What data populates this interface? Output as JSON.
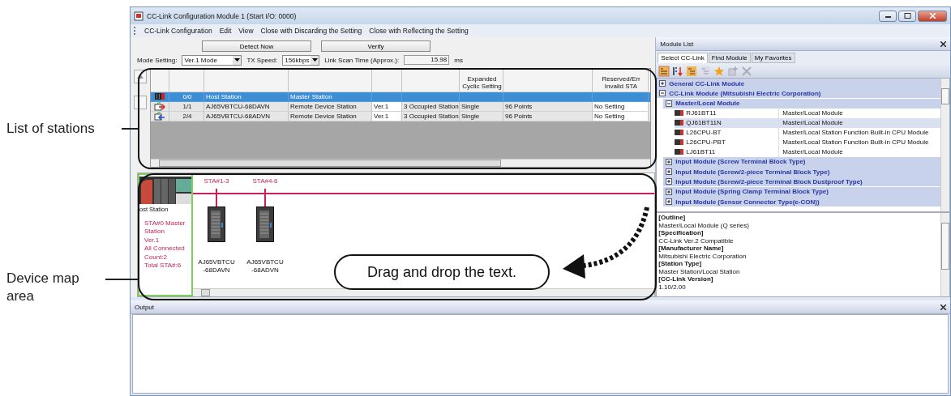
{
  "annotations": [
    {
      "text": "List of stations"
    },
    {
      "text": "Device map area"
    }
  ],
  "callout": {
    "text": "Drag and drop the text."
  },
  "window": {
    "title": "CC-Link Configuration Module 1 (Start I/O: 0000)"
  },
  "menu": [
    "CC-Link Configuration",
    "Edit",
    "View",
    "Close with Discarding the Setting",
    "Close with Reflecting the Setting"
  ],
  "toolbar": {
    "buttons": [
      "Detect Now",
      "Verify"
    ],
    "mode_label": "Mode Setting:",
    "mode_value": "Ver.1 Mode",
    "speed_label": "TX Speed:",
    "speed_value": "156kbps",
    "scan_label": "Link Scan Time (Approx.):",
    "scan_value": "15.98",
    "scan_unit": "ms"
  },
  "table": {
    "column_headers": {
      "column_7": "Expanded Cyclic Setting",
      "column_9": "Reserved/Err Invalid STA"
    },
    "rows": [
      {
        "kind": "master",
        "selected": true,
        "station_no": "0/0",
        "model": "Host Station",
        "station_type": "Master Station"
      },
      {
        "kind": "remote_out",
        "selected": false,
        "station_no": "1/1",
        "model": "AJ65VBTCU-68DAVN",
        "station_type": "Remote Device Station",
        "version": "Ver.1",
        "occupied": "3 Occupied Station",
        "expanded_cyclic": "Single",
        "points": "96 Points",
        "reserved": "No Setting"
      },
      {
        "kind": "remote_in",
        "selected": false,
        "station_no": "2/4",
        "model": "AJ65VBTCU-68ADVN",
        "station_type": "Remote Device Station",
        "version": "Ver.1",
        "occupied": "3 Occupied Station",
        "expanded_cyclic": "Single",
        "points": "96 Points",
        "reserved": "No Setting"
      }
    ]
  },
  "device_map": {
    "host": {
      "label": "ost Station",
      "info": [
        "STA#0  Master Station",
        "Ver.1",
        "All Connected Count:2",
        "Total STA#:6"
      ]
    },
    "devices": [
      {
        "range": "STA#1-3",
        "name": [
          "AJ65VBTCU",
          "-68DAVN"
        ]
      },
      {
        "range": "STA#4-6",
        "name": [
          "AJ65VBTCU",
          "-68ADVN"
        ]
      }
    ]
  },
  "module_list": {
    "title": "Module List",
    "tabs": [
      {
        "label": "Select CC-Link",
        "selected": true
      },
      {
        "label": "Find Module",
        "selected": false
      },
      {
        "label": "My Favorites",
        "selected": false
      }
    ],
    "tree": [
      {
        "kind": "group",
        "label": "General CC-Link Module",
        "expanded": false
      },
      {
        "kind": "group",
        "label": "CC-Link Module (Mitsubishi Electric Corporation)",
        "expanded": true,
        "children": [
          {
            "kind": "group",
            "label": "Master/Local Module",
            "expanded": true,
            "children": [
              {
                "kind": "module",
                "model": "RJ61BT11",
                "description": "Master/Local Module",
                "selected": false
              },
              {
                "kind": "module",
                "model": "QJ61BT11N",
                "description": "Master/Local Module",
                "selected": true
              },
              {
                "kind": "module",
                "model": "L26CPU-BT",
                "description": "Master/Local Station Function Built-in CPU Module",
                "selected": false
              },
              {
                "kind": "module",
                "model": "L26CPU-PBT",
                "description": "Master/Local Station Function Built-in CPU Module",
                "selected": false
              },
              {
                "kind": "module",
                "model": "LJ61BT11",
                "description": "Master/Local Module",
                "selected": false
              }
            ]
          },
          {
            "kind": "group",
            "label": "Input Module (Screw Terminal Block Type)",
            "expanded": false
          },
          {
            "kind": "group",
            "label": "Input Module (Screw/2-piece Terminal Block Type)",
            "expanded": false
          },
          {
            "kind": "group",
            "label": "Input Module (Screw/2-piece Terminal Block Dustproof Type)",
            "expanded": false
          },
          {
            "kind": "group",
            "label": "Input Module (Spring Clamp Terminal Block Type)",
            "expanded": false
          },
          {
            "kind": "group",
            "label": "Input Module (Sensor Connector Type(e-CON))",
            "expanded": false
          }
        ]
      }
    ],
    "details": [
      {
        "kind": "heading",
        "text": "[Outline]"
      },
      {
        "kind": "value",
        "text": "Master/Local Module (Q series)"
      },
      {
        "kind": "heading",
        "text": "[Specification]"
      },
      {
        "kind": "value",
        "text": "CC-Link Ver.2 Compatible"
      },
      {
        "kind": "heading",
        "text": "[Manufacturer Name]"
      },
      {
        "kind": "value",
        "text": "Mitsubishi Electric Corporation"
      },
      {
        "kind": "heading",
        "text": "[Station Type]"
      },
      {
        "kind": "value",
        "text": "Master Station/Local Station"
      },
      {
        "kind": "heading",
        "text": "[CC-Link Version]"
      },
      {
        "kind": "value",
        "text": "1.10/2.00"
      }
    ]
  },
  "output": {
    "title": "Output"
  }
}
